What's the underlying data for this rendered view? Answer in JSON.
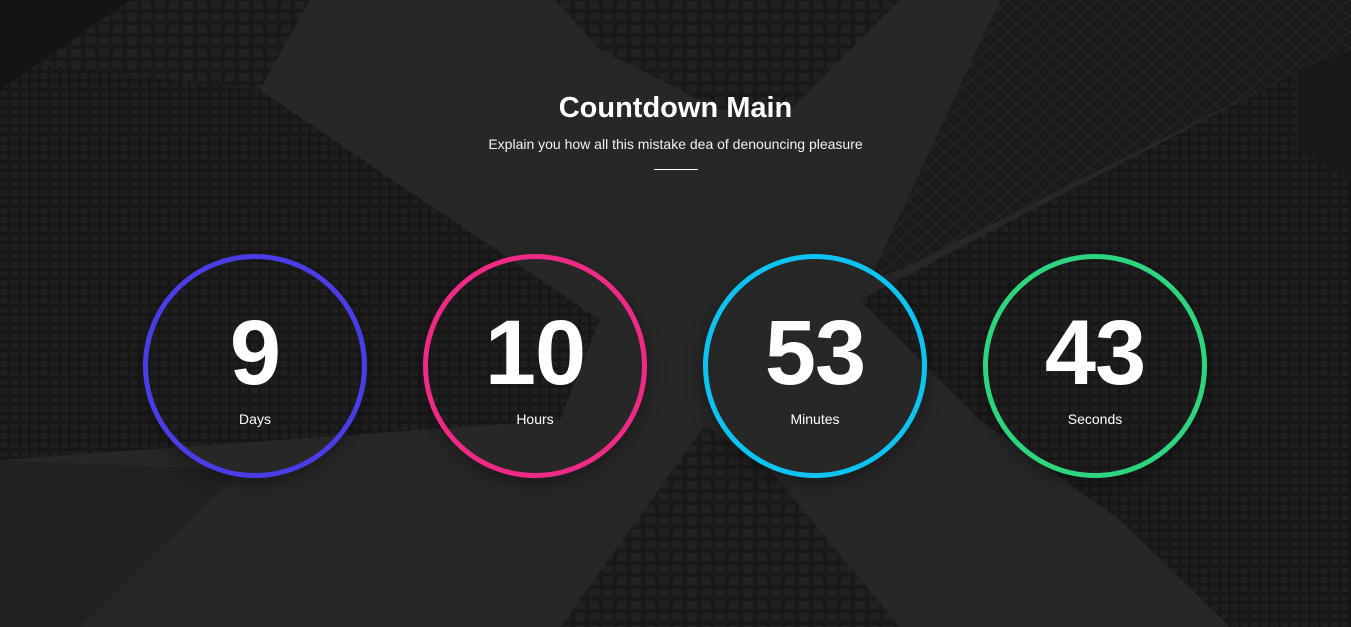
{
  "header": {
    "title": "Countdown Main",
    "subtitle": "Explain you how all this mistake dea of denouncing pleasure"
  },
  "countdown": [
    {
      "value": "9",
      "label": "Days",
      "color": "#4a3ce6"
    },
    {
      "value": "10",
      "label": "Hours",
      "color": "#ef2a86"
    },
    {
      "value": "53",
      "label": "Minutes",
      "color": "#0dc3f2"
    },
    {
      "value": "43",
      "label": "Seconds",
      "color": "#2ed57f"
    }
  ],
  "background": {
    "image": "skyscrapers-looking-up",
    "tone": "#2c2c2c"
  }
}
